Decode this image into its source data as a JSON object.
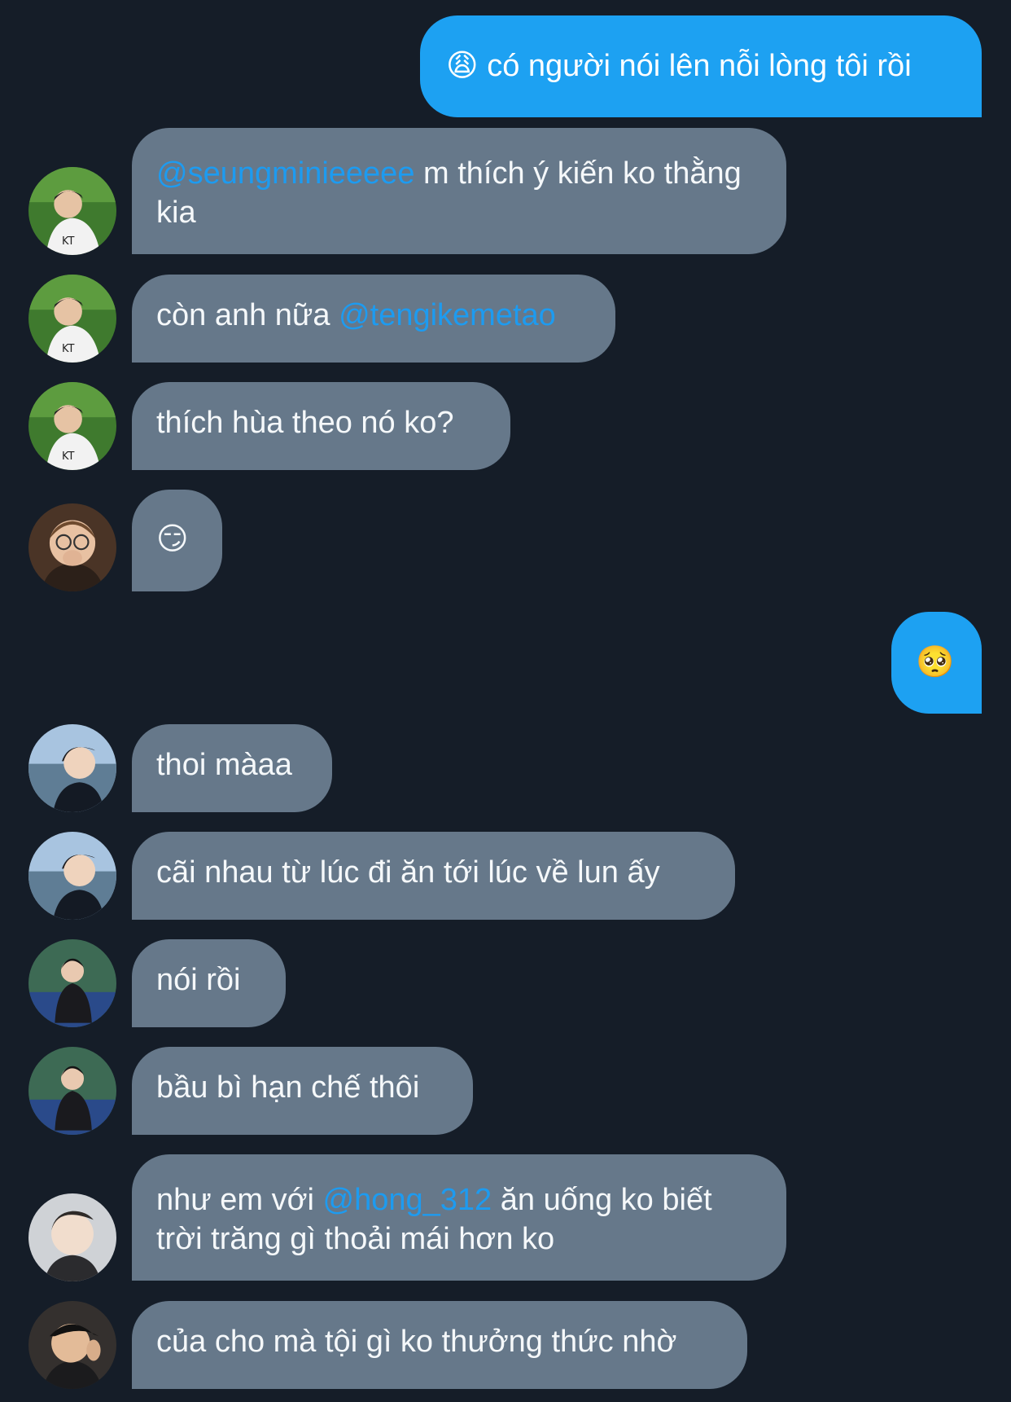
{
  "theme": {
    "background": "#151d28",
    "incoming_bubble": "#66788a",
    "outgoing_bubble": "#1da1f2",
    "mention_color": "#1d9bf0"
  },
  "messages": [
    {
      "sender": "me",
      "emoji": "😩",
      "text": "có người nói lên nỗi lòng tôi rồi"
    },
    {
      "sender": "user-1",
      "avatar": "baseball-jersey-avatar",
      "mention": "@seungminieeeee",
      "text": "m thích ý kiến ko thằng kia"
    },
    {
      "sender": "user-1",
      "avatar": "baseball-jersey-avatar",
      "text_before": "còn anh nữa",
      "mention": "@tengikemetao"
    },
    {
      "sender": "user-1",
      "avatar": "baseball-jersey-avatar",
      "text": "thích hùa theo nó ko?"
    },
    {
      "sender": "user-2",
      "avatar": "glasses-portrait-avatar",
      "emoji": "😏"
    },
    {
      "sender": "me",
      "emoji": "🥺"
    },
    {
      "sender": "user-3",
      "avatar": "seaside-profile-avatar",
      "text": "thoi màaa"
    },
    {
      "sender": "user-3",
      "avatar": "seaside-profile-avatar",
      "text": "cãi nhau từ lúc đi ăn tới lúc về lun ấy"
    },
    {
      "sender": "user-4",
      "avatar": "crouching-pose-avatar",
      "text": "nói rồi"
    },
    {
      "sender": "user-4",
      "avatar": "crouching-pose-avatar",
      "text": "bầu bì hạn chế thôi"
    },
    {
      "sender": "user-5",
      "avatar": "soft-portrait-avatar",
      "text_before": "như em với",
      "mention": "@hong_312",
      "text": "ăn uống ko biết trời trăng gì thoải mái hơn ko"
    },
    {
      "sender": "user-6",
      "avatar": "cap-selfie-avatar",
      "text": "của cho mà tội gì ko thưởng thức nhờ"
    }
  ]
}
